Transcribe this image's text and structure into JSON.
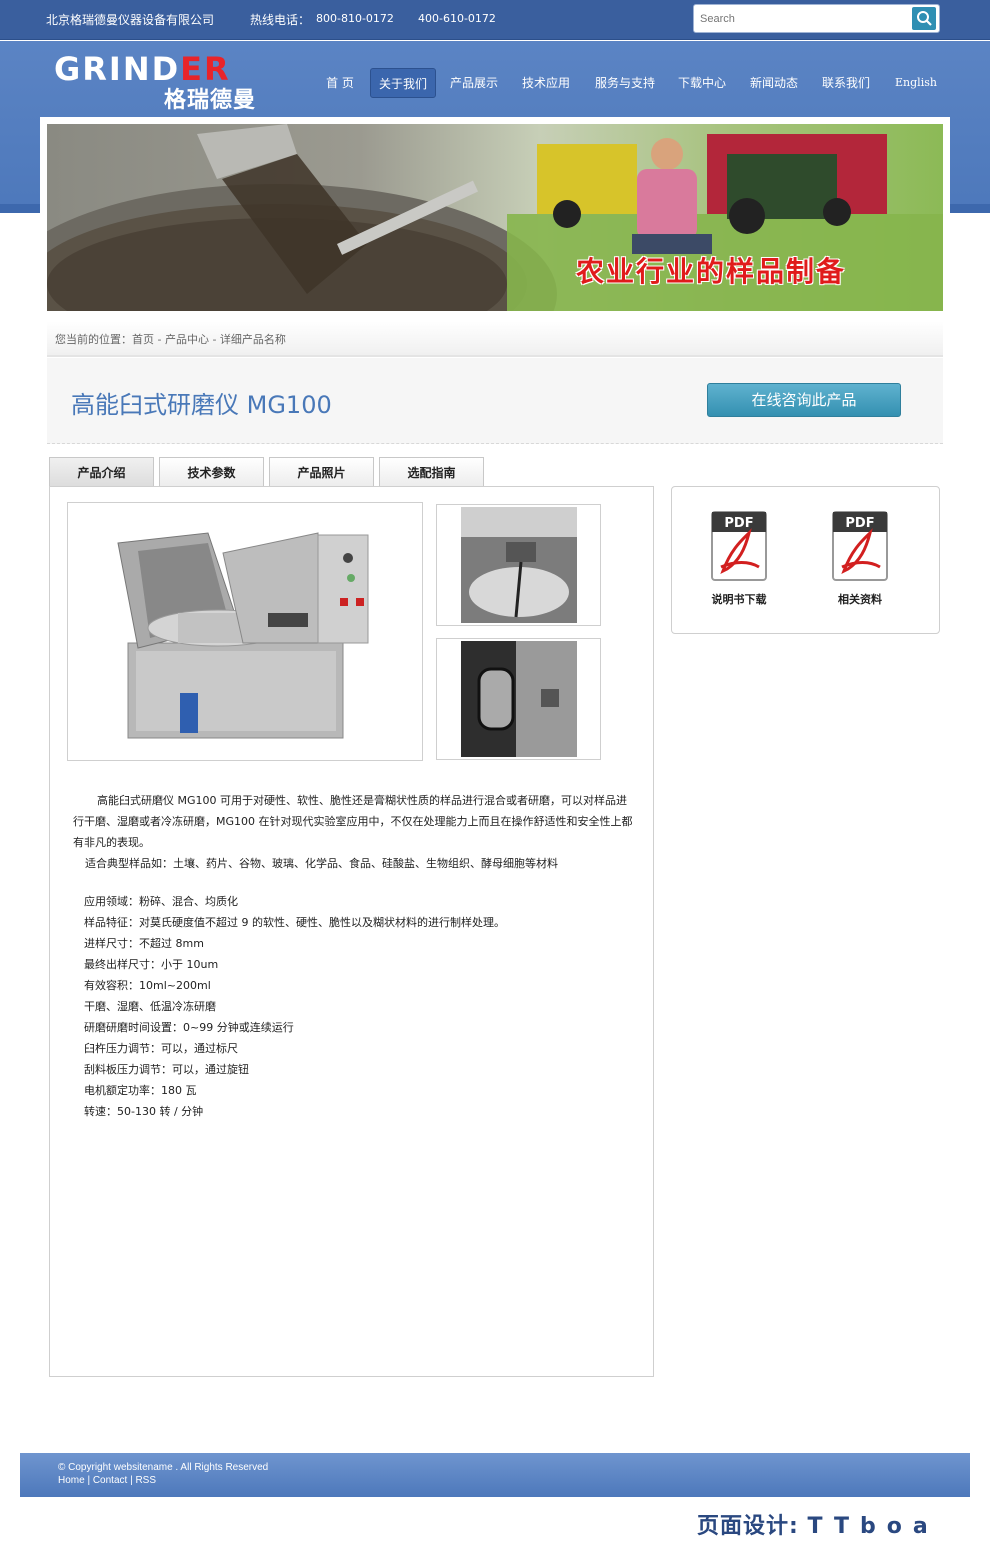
{
  "topbar": {
    "company": "北京格瑞德曼仪器设备有限公司",
    "hotline_label": "热线电话：",
    "phone1": "800-810-0172",
    "phone2": "400-610-0172",
    "search_placeholder": "Search"
  },
  "logo": {
    "main": "GRIND",
    "accent": "ER",
    "cn": "格瑞德曼"
  },
  "nav": [
    {
      "label": "首 页"
    },
    {
      "label": "关于我们"
    },
    {
      "label": "产品展示"
    },
    {
      "label": "技术应用"
    },
    {
      "label": "服务与支持"
    },
    {
      "label": "下载中心"
    },
    {
      "label": "新闻动态"
    },
    {
      "label": "联系我们"
    },
    {
      "label": "English"
    }
  ],
  "banner": {
    "caption": "农业行业的样品制备"
  },
  "breadcrumb": "您当前的位置：首页 - 产品中心 - 详细产品名称",
  "product": {
    "title": "高能臼式研磨仪 MG100",
    "consult_button": "在线咨询此产品"
  },
  "tabs": [
    {
      "label": "产品介绍"
    },
    {
      "label": "技术参数"
    },
    {
      "label": "产品照片"
    },
    {
      "label": "选配指南"
    }
  ],
  "description": {
    "para1": "高能臼式研磨仪 MG100 可用于对硬性、软性、脆性还是膏糊状性质的样品进行混合或者研磨，可以对样品进行干磨、湿磨或者冷冻研磨，MG100 在针对现代实验室应用中，不仅在处理能力上而且在操作舒适性和安全性上都有非凡的表现。",
    "para2": "适合典型样品如：土壤、药片、谷物、玻璃、化学品、食品、硅酸盐、生物组织、酵母细胞等材料"
  },
  "specs": [
    "应用领域：粉碎、混合、均质化",
    "样品特征：对莫氏硬度值不超过 9 的软性、硬性、脆性以及糊状材料的进行制样处理。",
    "进样尺寸：不超过 8mm",
    "最终出样尺寸：小于 10um",
    "有效容积：10ml~200ml",
    "干磨、湿磨、低温冷冻研磨",
    "研磨研磨时间设置：0~99 分钟或连续运行",
    "臼杵压力调节：可以，通过标尺",
    "刮料板压力调节：可以，通过旋钮",
    "电机额定功率：180 瓦",
    "转速：50-130 转 / 分钟"
  ],
  "downloads": [
    {
      "label": "说明书下载",
      "icon_text": "PDF"
    },
    {
      "label": "相关资料",
      "icon_text": "PDF"
    }
  ],
  "footer": {
    "copyright": "© Copyright websitename . All Rights Reserved",
    "links": "Home | Contact | RSS"
  },
  "designer": {
    "label": "页面设计:",
    "name": "TTboa"
  }
}
